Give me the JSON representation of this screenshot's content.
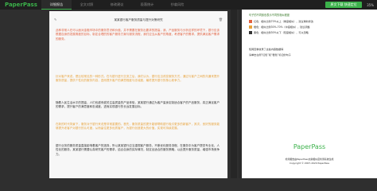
{
  "app": {
    "logo": "PaperPass",
    "tabs": [
      "详细报告",
      "全文对照",
      "修改建议",
      "段落统计",
      "抄袭风险"
    ],
    "download_button": "原文下载 快速定位",
    "progress": "35%"
  },
  "document": {
    "title": "某某银行客户服务质量与提升对策研究",
    "paragraphs": [
      {
        "color": "red",
        "text": "此种非常人在可以面对金融市场中的服务意识和价值，并不需要在服务出要求的提高，我，产品服务与分析这样的环境下，银行应该根据自身的发展角度的目标，制定合理的的客户服务方案与服务流程，我们应当从客户的角度，考虑客户的需求，提供满足客户需求的服务。"
      },
      {
        "color": "orange",
        "text": "针对客户来说，是比较常见的一种形式。在与银行进行交流之后，我们认为，银行应当改变服务方式，通过与客户之间的沟通来提升服务质量，提供个性化的服务内容，进而提升客户的满意程度与忠诚度，最终提升银行的核心竞争力。"
      },
      {
        "color": "black",
        "text": "随着人民生活水平的提高，人们也越来越关注高质量的产品体验，某某银行通过为客户量身定制适合客户的产品服务，真正满足客户的需求，提升客户的满意度和忠诚度，进而实现银行的长远发展目标。"
      },
      {
        "color": "orange",
        "text": "在新的时代背景下，服务对于银行来说是非常重要的。首先，服务质量的提升能够帮助银行吸引更多的新客户，其次，良好的服务能够提升老客户对银行的认可度，从而留住更多优质客户，为银行创造更大的价值，实现可持续发展。"
      },
      {
        "color": "black",
        "text": "银行业务的服务质量直接影响着客户的选择，所以某某银行应当重视客户服务，不断优化服务流程，在服务中为客户提供专业化、人性化的服务，某某银行需要认真研究客户的需求，结合自身的实际情况，制定出适合的服务策略，以此提升服务质量，增强市场竞争力。"
      }
    ]
  },
  "report": {
    "legend_title": "句子的不同颜色表示不同的相似程度",
    "legend": [
      {
        "label": "红色：相似比例70%以上（重度相似），建议重新修改",
        "color": "#e2603f"
      },
      {
        "label": "橙色：相似比例30%-70%（中度相似），建议调整",
        "color": "#e8a33c"
      },
      {
        "label": "黑色：相似比例30%以下（轻度相似），可以忽略",
        "color": "#333333"
      }
    ],
    "note_title": "知网查重收录了这些内容数据库",
    "note_text": "请单击左侧“红色”和“橙色”标记的句子",
    "bottom_logo": "PaperPass",
    "bottom_line1": "检测报告由PaperPass文献相似度检测系统生成",
    "bottom_line2": "Copyright © 2007-2020 PaperPass"
  }
}
